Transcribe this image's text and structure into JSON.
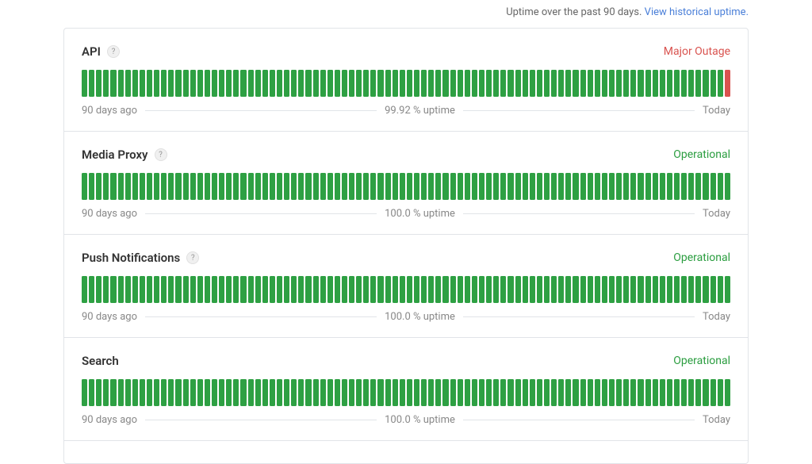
{
  "header": {
    "note_prefix": "Uptime over the past 90 days. ",
    "link_text": "View historical uptime."
  },
  "labels": {
    "start": "90 days ago",
    "end": "Today",
    "uptime_suffix": " % uptime"
  },
  "components": [
    {
      "name": "API",
      "help": true,
      "status_text": "Major Outage",
      "status_class": "status-major-outage",
      "uptime": "99.92",
      "days": 90,
      "outage_indices": [
        89
      ]
    },
    {
      "name": "Media Proxy",
      "help": true,
      "status_text": "Operational",
      "status_class": "status-operational",
      "uptime": "100.0",
      "days": 90,
      "outage_indices": []
    },
    {
      "name": "Push Notifications",
      "help": true,
      "status_text": "Operational",
      "status_class": "status-operational",
      "uptime": "100.0",
      "days": 90,
      "outage_indices": []
    },
    {
      "name": "Search",
      "help": false,
      "status_text": "Operational",
      "status_class": "status-operational",
      "uptime": "100.0",
      "days": 90,
      "outage_indices": []
    }
  ]
}
